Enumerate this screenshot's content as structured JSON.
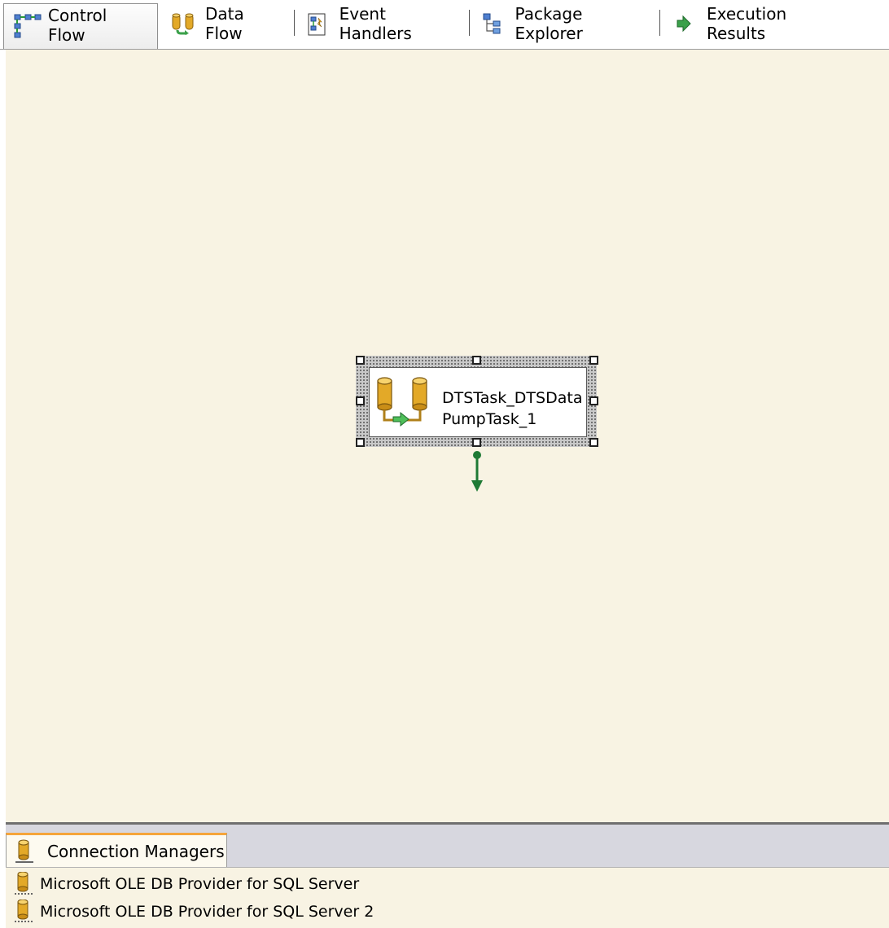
{
  "tabs": [
    {
      "label": "Control Flow",
      "icon": "control-flow-icon",
      "active": true
    },
    {
      "label": "Data Flow",
      "icon": "data-flow-icon",
      "active": false
    },
    {
      "label": "Event Handlers",
      "icon": "event-handlers-icon",
      "active": false
    },
    {
      "label": "Package Explorer",
      "icon": "package-explorer-icon",
      "active": false
    },
    {
      "label": "Execution Results",
      "icon": "execution-results-icon",
      "active": false
    }
  ],
  "task": {
    "label": "DTSTask_DTSDataPumpTask_1",
    "icon": "data-pump-task-icon"
  },
  "connection_managers": {
    "tab_label": "Connection Managers",
    "items": [
      {
        "label": "Microsoft OLE DB Provider for SQL Server",
        "icon": "database-connection-icon"
      },
      {
        "label": "Microsoft OLE DB Provider for SQL Server 2",
        "icon": "database-connection-icon"
      }
    ]
  },
  "colors": {
    "canvas_bg": "#f8f3e3",
    "success_arrow": "#1f7a35",
    "cylinder_gold": "#e3a928"
  }
}
